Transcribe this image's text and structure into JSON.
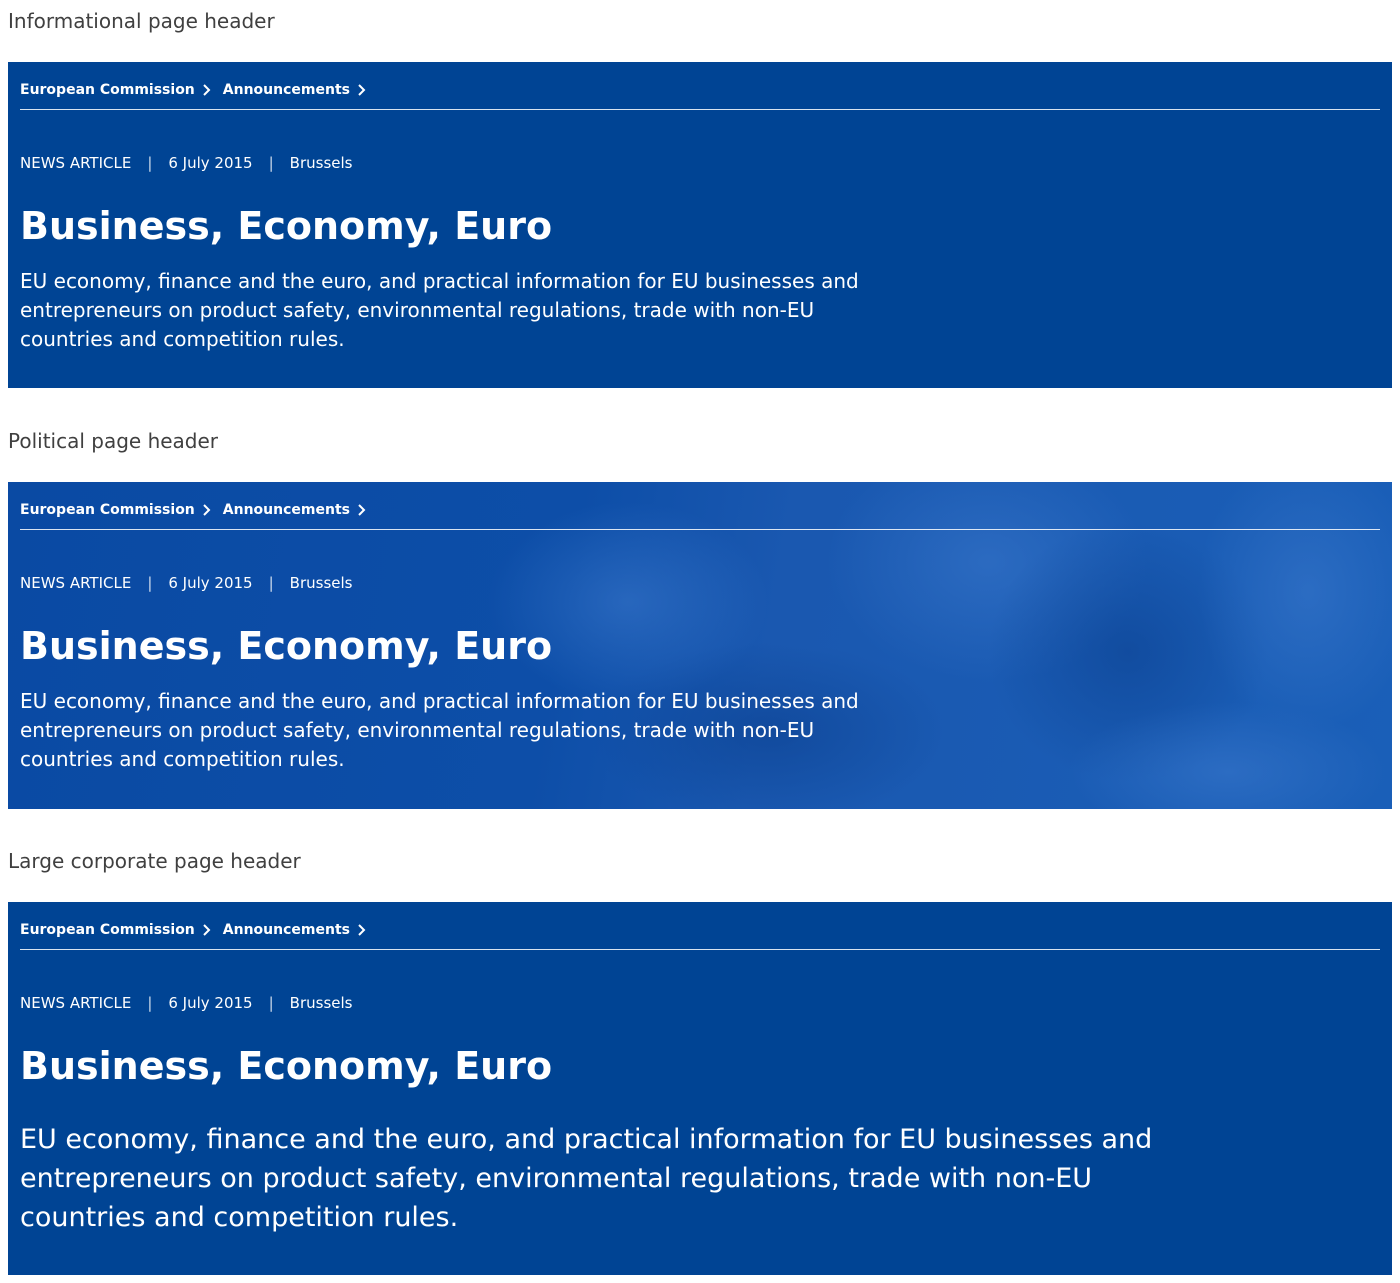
{
  "sections": [
    {
      "heading": "Informational page header",
      "breadcrumb": [
        "European Commission",
        "Announcements"
      ],
      "meta": {
        "type": "NEWS ARTICLE",
        "date": "6 July 2015",
        "location": "Brussels"
      },
      "title": "Business, Economy, Euro",
      "description": "EU economy, finance and the euro, and practical information for EU businesses and entrepreneurs on product safety, environmental regulations, trade with non-EU countries and competition rules."
    },
    {
      "heading": "Political page header",
      "breadcrumb": [
        "European Commission",
        "Announcements"
      ],
      "meta": {
        "type": "NEWS ARTICLE",
        "date": "6 July 2015",
        "location": "Brussels"
      },
      "title": "Business, Economy, Euro",
      "description": "EU economy, finance and the euro, and practical information for EU businesses and entrepreneurs on product safety, environmental regulations, trade with non-EU countries and competition rules."
    },
    {
      "heading": "Large corporate page header",
      "breadcrumb": [
        "European Commission",
        "Announcements"
      ],
      "meta": {
        "type": "NEWS ARTICLE",
        "date": "6 July 2015",
        "location": "Brussels"
      },
      "title": "Business, Economy, Euro",
      "description": "EU economy, finance and the euro, and practical information for EU businesses and entrepreneurs on product safety, environmental regulations, trade with non-EU countries and competition rules."
    }
  ],
  "colors": {
    "header_background": "#004494",
    "header_text": "#ffffff",
    "section_heading_text": "#404040"
  }
}
